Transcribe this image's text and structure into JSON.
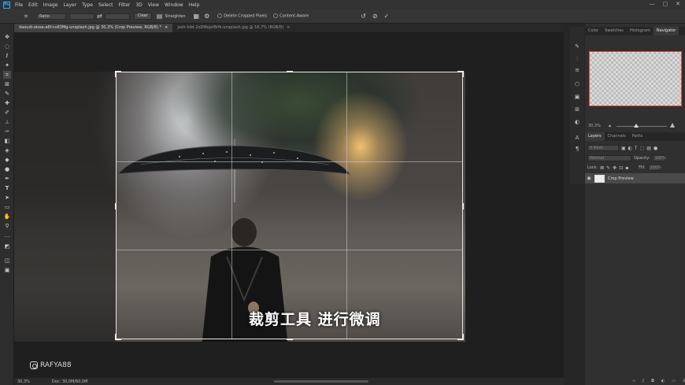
{
  "menubar": {
    "items": [
      "File",
      "Edit",
      "Image",
      "Layer",
      "Type",
      "Select",
      "Filter",
      "3D",
      "View",
      "Window",
      "Help"
    ],
    "app_logo": "Ps"
  },
  "options": {
    "ratio_select": "Ratio",
    "clear_label": "Clear",
    "straighten_label": "Straighten",
    "delete_cropped_label": "Delete Cropped Pixels",
    "content_aware_label": "Content-Aware"
  },
  "tabs": [
    {
      "title": "daoudi-aissa-a6f-cv63Mg-unsplash.jpg @ 30,3% (Crop Preview, RGB/8) *",
      "close": "×"
    },
    {
      "title": "josh-hild-2oDMojol8rfk-unsplash.jpg @ 16,7% (RGB/8)",
      "close": "×"
    }
  ],
  "canvas": {
    "subtitle": "裁剪工具 进行微调",
    "watermark": "RAFYA88"
  },
  "statusbar": {
    "zoom": "30,3%",
    "doc_info": "Doc: 30,0M/60,0M"
  },
  "panels": {
    "top_tabs": [
      "Color",
      "Swatches",
      "Histogram",
      "Navigator"
    ],
    "navigator_zoom": "30,3%",
    "layer_tabs": [
      "Layers",
      "Channels",
      "Paths"
    ],
    "kind_label": "Kind",
    "blend_mode": "Normal",
    "opacity_label": "Opacity:",
    "opacity_value": "100%",
    "lock_label": "Lock:",
    "fill_label": "Fill:",
    "fill_value": "100%",
    "layer_name": "Crop Preview"
  },
  "colors": {
    "accent": "#31a8ff",
    "navigator_frame": "#e34b3a"
  }
}
